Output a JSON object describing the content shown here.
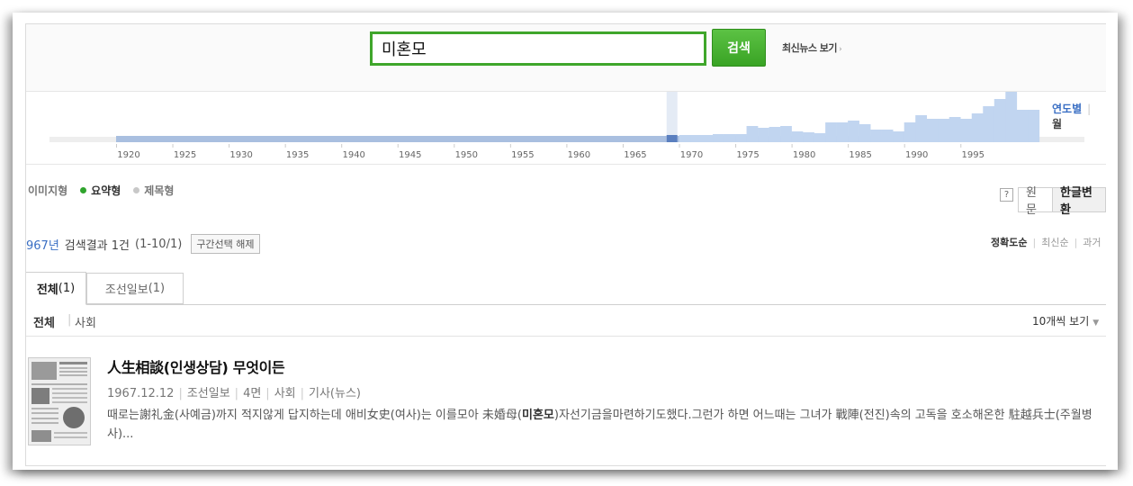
{
  "search": {
    "query": "미혼모",
    "button_label": "검색",
    "latest_news_label": "최신뉴스 보기",
    "latest_news_arrow": "›"
  },
  "timeline": {
    "tick_labels": [
      "1920",
      "1925",
      "1930",
      "1935",
      "1940",
      "1945",
      "1950",
      "1955",
      "1960",
      "1965",
      "1970",
      "1975",
      "1980",
      "1985",
      "1990",
      "1995"
    ],
    "selected_year": "1967",
    "view_by_year": "연도별",
    "view_by_month": "월",
    "colors": {
      "bar": "#c1d5f0",
      "selected": "#5a7fbf",
      "baseline": "#a9bfe0"
    }
  },
  "view_types": {
    "image": "이미지형",
    "summary": "요약형",
    "title": "제목형"
  },
  "help_icon": "?",
  "language": {
    "original": "원문",
    "hangul": "한글변환"
  },
  "results_summary": {
    "year_label": "967년",
    "result_text": "검색결과 1건",
    "range": "(1-10/1)",
    "clear_button": "구간선택 해제"
  },
  "sort": {
    "accuracy": "정확도순",
    "latest": "최신순",
    "past": "과거"
  },
  "tabs": [
    {
      "label": "전체",
      "count": "(1)"
    },
    {
      "label": "조선일보",
      "count": "(1)"
    }
  ],
  "categories": {
    "all": "전체",
    "society": "사회",
    "per_page": "10개씩 보기"
  },
  "result": {
    "title": "人生相談(인생상담) 무엇이든",
    "meta": {
      "date": "1967.12.12",
      "paper": "조선일보",
      "page": "4면",
      "section": "사회",
      "type": "기사(뉴스)"
    },
    "snippet_before": "때로는謝礼金(사예금)까지 적지않게 답지하는데 애비女史(여사)는 이를모아 未婚母(",
    "snippet_highlight": "미혼모",
    "snippet_after": ")자선기금을마련하기도했다.그런가 하면 어느때는 그녀가 戰陣(전진)속의 고독을 호소해온한 駐越兵士(주월병사)..."
  }
}
